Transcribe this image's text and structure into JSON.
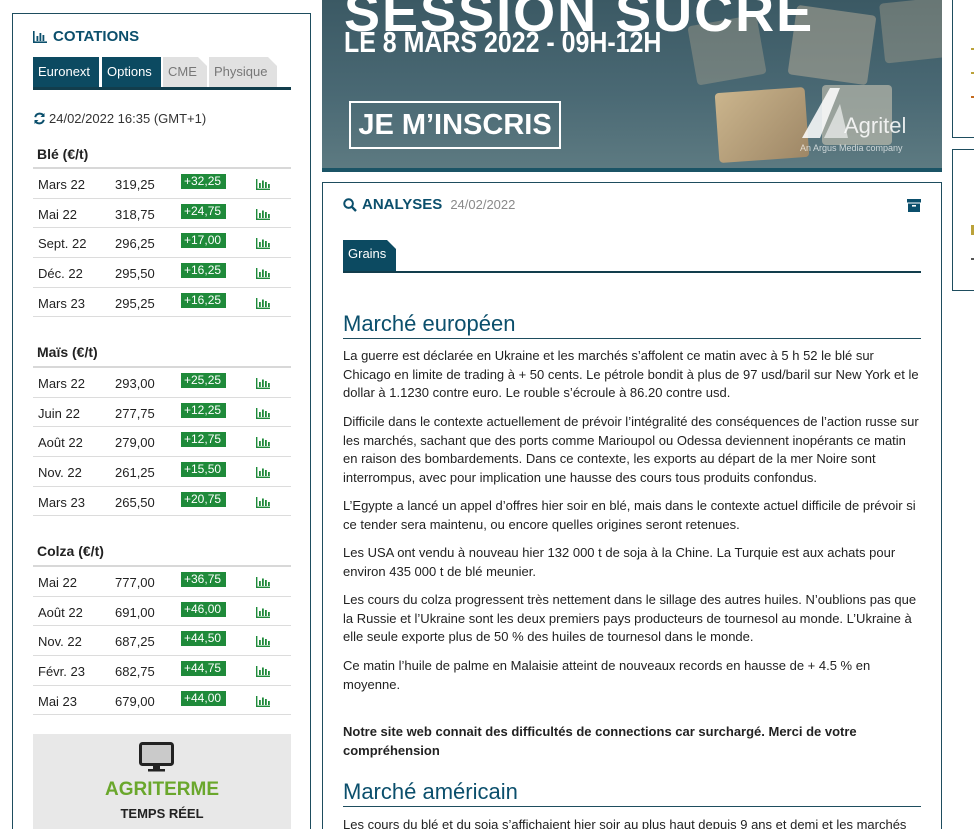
{
  "cotations": {
    "title": "COTATIONS",
    "tabs": [
      "Euronext",
      "Options",
      "CME",
      "Physique"
    ],
    "updated": "24/02/2022 16:35 (GMT+1)",
    "groups": [
      {
        "name": "Blé (€/t)",
        "rows": [
          {
            "month": "Mars 22",
            "price": "319,25",
            "change": "+32,25"
          },
          {
            "month": "Mai 22",
            "price": "318,75",
            "change": "+24,75"
          },
          {
            "month": "Sept. 22",
            "price": "296,25",
            "change": "+17,00"
          },
          {
            "month": "Déc. 22",
            "price": "295,50",
            "change": "+16,25"
          },
          {
            "month": "Mars 23",
            "price": "295,25",
            "change": "+16,25"
          }
        ]
      },
      {
        "name": "Maïs (€/t)",
        "rows": [
          {
            "month": "Mars 22",
            "price": "293,00",
            "change": "+25,25"
          },
          {
            "month": "Juin 22",
            "price": "277,75",
            "change": "+12,25"
          },
          {
            "month": "Août 22",
            "price": "279,00",
            "change": "+12,75"
          },
          {
            "month": "Nov. 22",
            "price": "261,25",
            "change": "+15,50"
          },
          {
            "month": "Mars 23",
            "price": "265,50",
            "change": "+20,75"
          }
        ]
      },
      {
        "name": "Colza (€/t)",
        "rows": [
          {
            "month": "Mai 22",
            "price": "777,00",
            "change": "+36,75"
          },
          {
            "month": "Août 22",
            "price": "691,00",
            "change": "+46,00"
          },
          {
            "month": "Nov. 22",
            "price": "687,25",
            "change": "+44,50"
          },
          {
            "month": "Févr. 23",
            "price": "682,75",
            "change": "+44,75"
          },
          {
            "month": "Mai 23",
            "price": "679,00",
            "change": "+44,00"
          }
        ]
      }
    ],
    "agriterme": {
      "title": "AGRITERME",
      "subtitle": "TEMPS RÉEL"
    }
  },
  "banner": {
    "headline": "SESSION SUCRE",
    "date": "LE 8 MARS 2022 - 09H-12H",
    "button": "JE M’INSCRIS",
    "brand": "Agritel",
    "brand_sub": "An Argus Media company"
  },
  "analyses": {
    "title": "ANALYSES",
    "date": "24/02/2022",
    "tab": "Grains",
    "sections": [
      {
        "heading": "Marché européen"
      },
      {
        "heading": "Marché américain"
      }
    ],
    "paragraphs": [
      "La guerre est déclarée en Ukraine et les marchés s’affolent ce matin avec à 5 h 52 le blé sur Chicago en limite de trading à + 50 cents. Le pétrole bondit à plus de 97 usd/baril sur New York et le dollar à 1.1230 contre euro. Le rouble s’écroule à 86.20 contre usd.",
      "Difficile dans le contexte actuellement de prévoir l’intégralité des conséquences de l’action russe sur les marchés, sachant que des ports comme Marioupol ou Odessa deviennent inopérants ce matin en raison des bombardements. Dans ce contexte, les exports au départ de la mer Noire sont interrompus, avec pour implication une hausse des cours tous produits confondus.",
      "L’Egypte a lancé un appel d’offres hier soir en blé, mais dans le contexte actuel difficile de prévoir si ce tender sera maintenu, ou encore quelles origines seront retenues.",
      "Les USA ont vendu à nouveau hier 132 000 t de soja à la Chine. La Turquie est aux achats pour environ 435 000 t de blé meunier.",
      "Les cours du colza progressent très nettement dans le sillage des autres huiles. N’oublions pas que la Russie et l’Ukraine sont les deux premiers pays producteurs de tournesol au monde. L’Ukraine à elle seule exporte plus de 50 % des huiles de tournesol dans le monde.",
      "Ce matin l’huile de palme en Malaisie atteint de nouveaux records en hausse de + 4.5 % en moyenne."
    ],
    "notice": "Notre site web connait des difficultés de connections car surchargé. Merci de votre compréhension",
    "us_paragraph": "Les cours du blé et du soja s’affichaient hier soir au plus haut depuis 9 ans et demi et les marchés"
  },
  "colors": {
    "brand": "#0b4f6c",
    "positive": "#1f8a3a",
    "agriterme": "#6aa72c"
  }
}
